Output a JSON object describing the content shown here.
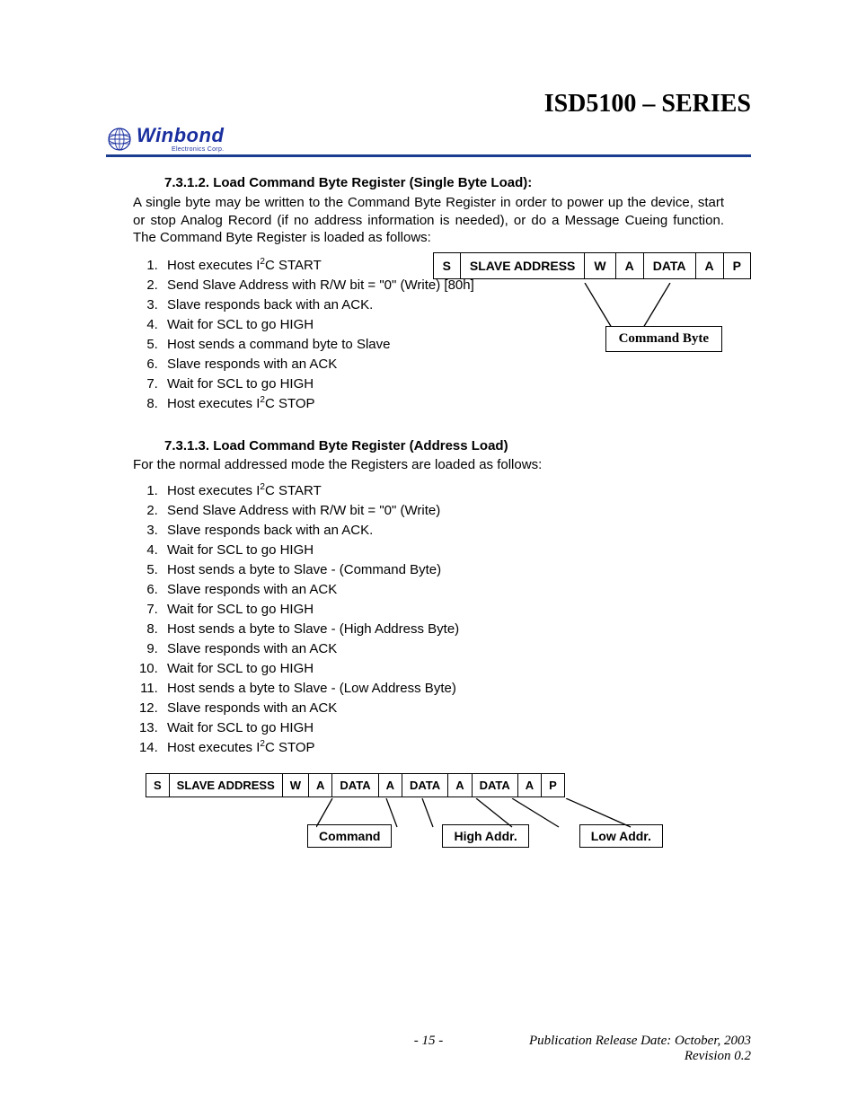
{
  "header": {
    "series_title": "ISD5100 – SERIES",
    "logo_name": "Winbond",
    "logo_sub": "Electronics Corp."
  },
  "section1": {
    "heading": "7.3.1.2. Load Command Byte Register (Single Byte Load):",
    "paragraph": "A single byte may be written to the Command Byte Register in order to power up the device, start or stop Analog Record (if no address information is needed), or do a Message Cueing function. The Command Byte Register is loaded as follows:",
    "steps": [
      "Host executes I²C START",
      "Send Slave Address with R/W bit = \"0\" (Write) [80h]",
      "Slave responds back with an ACK.",
      "Wait for SCL to go HIGH",
      "Host sends a command byte to Slave",
      "Slave responds with an ACK",
      "Wait for SCL to go HIGH",
      "Host executes I²C STOP"
    ],
    "proto": [
      "S",
      "SLAVE ADDRESS",
      "W",
      "A",
      "DATA",
      "A",
      "P"
    ],
    "annotation": "Command Byte"
  },
  "section2": {
    "heading": "7.3.1.3. Load Command Byte Register (Address Load)",
    "paragraph": "For the normal addressed mode the Registers are loaded as follows:",
    "steps": [
      "Host executes I²C START",
      "Send Slave Address with R/W bit = \"0\" (Write)",
      "Slave responds back with an ACK.",
      "Wait for SCL to go HIGH",
      "Host sends a byte to Slave - (Command Byte)",
      "Slave responds with an ACK",
      "Wait for SCL to go HIGH",
      "Host sends a byte to Slave - (High Address Byte)",
      "Slave responds with an ACK",
      "Wait for SCL to go HIGH",
      "Host sends a byte to Slave - (Low Address Byte)",
      "Slave responds with an ACK",
      "Wait for SCL to go HIGH",
      "Host executes I²C STOP"
    ],
    "proto": [
      "S",
      "SLAVE ADDRESS",
      "W",
      "A",
      "DATA",
      "A",
      "DATA",
      "A",
      "DATA",
      "A",
      "P"
    ],
    "annotations": [
      "Command",
      "High Addr.",
      "Low Addr."
    ]
  },
  "footer": {
    "release": "Publication Release Date: October, 2003",
    "page": "- 15 -",
    "revision": "Revision 0.2"
  }
}
